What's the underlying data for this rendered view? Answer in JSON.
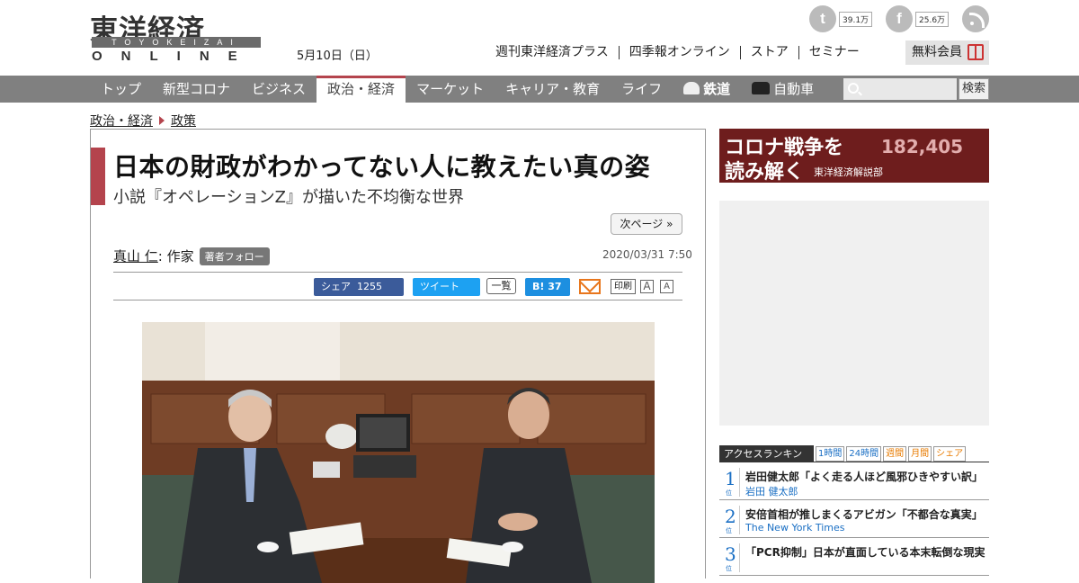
{
  "header": {
    "logo_kanji": "東洋経済",
    "logo_romaji": "TOYOKEIZAI",
    "logo_online": "ONLINE",
    "date": "5月10日（日）",
    "top_links": [
      "週刊東洋経済プラス",
      "四季報オンライン",
      "ストア",
      "セミナー"
    ],
    "member_label": "無料会員",
    "twitter_count": "39.1万",
    "facebook_count": "25.6万"
  },
  "nav": {
    "items": [
      "トップ",
      "新型コロナ",
      "ビジネス",
      "政治・経済",
      "マーケット",
      "キャリア・教育",
      "ライフ",
      "鉄道",
      "自動車"
    ],
    "active": "政治・経済",
    "search_placeholder": "",
    "search_button": "検索"
  },
  "breadcrumb": [
    "政治・経済",
    "政策"
  ],
  "article": {
    "title": "日本の財政がわかってない人に教えたい真の姿",
    "subtitle": "小説『オペレーションZ』が描いた不均衡な世界",
    "next_page": "次ページ »",
    "author": "真山 仁",
    "author_role": ": 作家",
    "follow_label": "著者フォロー",
    "date": "2020/03/31 7:50",
    "share": {
      "fb_label": "シェア",
      "fb_count": "1255",
      "tweet_label": "ツイート",
      "list_label": "一覧",
      "hatena_label": "B!",
      "hatena_count": "37",
      "print_label": "印刷",
      "font_large": "A",
      "font_small": "A"
    }
  },
  "sidebar": {
    "ad_line1": "コロナ戦争を",
    "ad_line2": "読み解く",
    "ad_sub": "東洋経済解説部",
    "ad_number": "182,405",
    "ranking_title": "アクセスランキング",
    "ranking_tabs": [
      "1時間",
      "24時間",
      "週間",
      "月間",
      "シェア"
    ],
    "rank_suffix": "位",
    "ranking": [
      {
        "rank": "1",
        "title": "岩田健太郎「よく走る人ほど風邪ひきやすい訳」",
        "author": "岩田 健太郎"
      },
      {
        "rank": "2",
        "title": "安倍首相が推しまくるアビガン「不都合な真実」",
        "author": "The New York Times"
      },
      {
        "rank": "3",
        "title": "「PCR抑制」日本が直面している本末転倒な現実",
        "author": ""
      }
    ]
  },
  "colors": {
    "accent": "#b4444d",
    "nav_bg": "#808080",
    "link": "#1a6fc4"
  }
}
